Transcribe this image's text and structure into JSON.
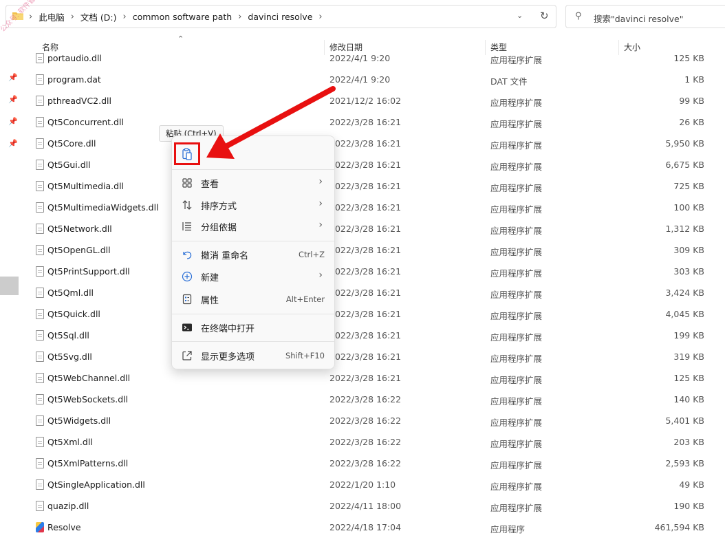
{
  "address": {
    "crumbs": [
      "此电脑",
      "文档 (D:)",
      "common software path",
      "davinci resolve"
    ],
    "separator": "›"
  },
  "search": {
    "placeholder": "搜索\"davinci resolve\""
  },
  "watermark": "公众号: 软件管家",
  "columns": {
    "name": "名称",
    "date": "修改日期",
    "type": "类型",
    "size": "大小"
  },
  "files": [
    {
      "name": "portaudio.dll",
      "date": "2022/4/1 9:20",
      "type": "应用程序扩展",
      "size": "125 KB",
      "icon": "dll"
    },
    {
      "name": "program.dat",
      "date": "2022/4/1 9:20",
      "type": "DAT 文件",
      "size": "1 KB",
      "icon": "file"
    },
    {
      "name": "pthreadVC2.dll",
      "date": "2021/12/2 16:02",
      "type": "应用程序扩展",
      "size": "99 KB",
      "icon": "dll"
    },
    {
      "name": "Qt5Concurrent.dll",
      "date": "2022/3/28 16:21",
      "type": "应用程序扩展",
      "size": "26 KB",
      "icon": "dll"
    },
    {
      "name": "Qt5Core.dll",
      "date": "2022/3/28 16:21",
      "type": "应用程序扩展",
      "size": "5,950 KB",
      "icon": "dll"
    },
    {
      "name": "Qt5Gui.dll",
      "date": "2022/3/28 16:21",
      "type": "应用程序扩展",
      "size": "6,675 KB",
      "icon": "dll"
    },
    {
      "name": "Qt5Multimedia.dll",
      "date": "2022/3/28 16:21",
      "type": "应用程序扩展",
      "size": "725 KB",
      "icon": "dll"
    },
    {
      "name": "Qt5MultimediaWidgets.dll",
      "date": "2022/3/28 16:21",
      "type": "应用程序扩展",
      "size": "100 KB",
      "icon": "dll"
    },
    {
      "name": "Qt5Network.dll",
      "date": "2022/3/28 16:21",
      "type": "应用程序扩展",
      "size": "1,312 KB",
      "icon": "dll"
    },
    {
      "name": "Qt5OpenGL.dll",
      "date": "2022/3/28 16:21",
      "type": "应用程序扩展",
      "size": "309 KB",
      "icon": "dll"
    },
    {
      "name": "Qt5PrintSupport.dll",
      "date": "2022/3/28 16:21",
      "type": "应用程序扩展",
      "size": "303 KB",
      "icon": "dll"
    },
    {
      "name": "Qt5Qml.dll",
      "date": "2022/3/28 16:21",
      "type": "应用程序扩展",
      "size": "3,424 KB",
      "icon": "dll"
    },
    {
      "name": "Qt5Quick.dll",
      "date": "2022/3/28 16:21",
      "type": "应用程序扩展",
      "size": "4,045 KB",
      "icon": "dll"
    },
    {
      "name": "Qt5Sql.dll",
      "date": "2022/3/28 16:21",
      "type": "应用程序扩展",
      "size": "199 KB",
      "icon": "dll"
    },
    {
      "name": "Qt5Svg.dll",
      "date": "2022/3/28 16:21",
      "type": "应用程序扩展",
      "size": "319 KB",
      "icon": "dll"
    },
    {
      "name": "Qt5WebChannel.dll",
      "date": "2022/3/28 16:21",
      "type": "应用程序扩展",
      "size": "125 KB",
      "icon": "dll"
    },
    {
      "name": "Qt5WebSockets.dll",
      "date": "2022/3/28 16:22",
      "type": "应用程序扩展",
      "size": "140 KB",
      "icon": "dll"
    },
    {
      "name": "Qt5Widgets.dll",
      "date": "2022/3/28 16:22",
      "type": "应用程序扩展",
      "size": "5,401 KB",
      "icon": "dll"
    },
    {
      "name": "Qt5Xml.dll",
      "date": "2022/3/28 16:22",
      "type": "应用程序扩展",
      "size": "203 KB",
      "icon": "dll"
    },
    {
      "name": "Qt5XmlPatterns.dll",
      "date": "2022/3/28 16:22",
      "type": "应用程序扩展",
      "size": "2,593 KB",
      "icon": "dll"
    },
    {
      "name": "QtSingleApplication.dll",
      "date": "2022/1/20 1:10",
      "type": "应用程序扩展",
      "size": "49 KB",
      "icon": "dll"
    },
    {
      "name": "quazip.dll",
      "date": "2022/4/11 18:00",
      "type": "应用程序扩展",
      "size": "190 KB",
      "icon": "dll"
    },
    {
      "name": "Resolve",
      "date": "2022/4/18 17:04",
      "type": "应用程序",
      "size": "461,594 KB",
      "icon": "exe"
    }
  ],
  "tooltip": "粘贴 (Ctrl+V)",
  "menu": {
    "view": "查看",
    "sort": "排序方式",
    "group": "分组依据",
    "undo": "撤消 重命名",
    "undo_shortcut": "Ctrl+Z",
    "new": "新建",
    "properties": "属性",
    "properties_shortcut": "Alt+Enter",
    "terminal": "在终端中打开",
    "more": "显示更多选项",
    "more_shortcut": "Shift+F10"
  },
  "colors": {
    "highlight": "#e81010",
    "arrow": "#e81010"
  }
}
